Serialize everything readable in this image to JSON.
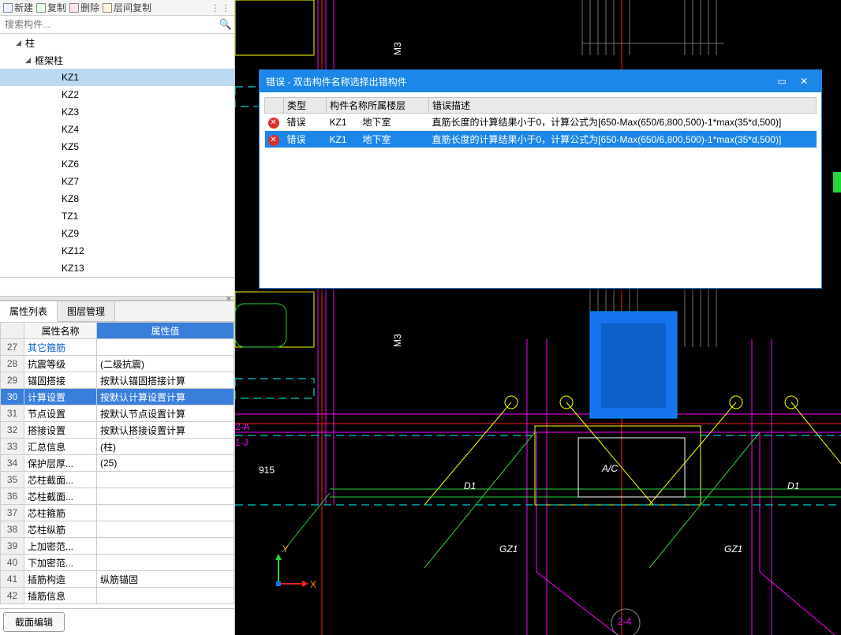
{
  "toolbar": {
    "new": "新建",
    "copy": "复制",
    "delete": "删除",
    "layerCopy": "层间复制"
  },
  "search": {
    "placeholder": "搜索构件..."
  },
  "tree": {
    "root": "柱",
    "group": "框架柱",
    "items": [
      "KZ1",
      "KZ2",
      "KZ3",
      "KZ4",
      "KZ5",
      "KZ6",
      "KZ7",
      "KZ8",
      "TZ1",
      "KZ9",
      "KZ12",
      "KZ13"
    ],
    "selected": "KZ1"
  },
  "tabs": {
    "props": "属性列表",
    "layers": "图层管理"
  },
  "propHeaders": {
    "name": "属性名称",
    "value": "属性值"
  },
  "propRows": [
    {
      "n": "27",
      "name": "其它箍筋",
      "value": "",
      "blue": true
    },
    {
      "n": "28",
      "name": "抗震等级",
      "value": "(二级抗震)"
    },
    {
      "n": "29",
      "name": "锚固搭接",
      "value": "按默认锚固搭接计算"
    },
    {
      "n": "30",
      "name": "计算设置",
      "value": "按默认计算设置计算",
      "sel": true
    },
    {
      "n": "31",
      "name": "节点设置",
      "value": "按默认节点设置计算"
    },
    {
      "n": "32",
      "name": "搭接设置",
      "value": "按默认搭接设置计算"
    },
    {
      "n": "33",
      "name": "汇总信息",
      "value": "(柱)"
    },
    {
      "n": "34",
      "name": "保护层厚...",
      "value": "(25)"
    },
    {
      "n": "35",
      "name": "芯柱截面...",
      "value": ""
    },
    {
      "n": "36",
      "name": "芯柱截面...",
      "value": ""
    },
    {
      "n": "37",
      "name": "芯柱箍筋",
      "value": ""
    },
    {
      "n": "38",
      "name": "芯柱纵筋",
      "value": ""
    },
    {
      "n": "39",
      "name": "上加密范...",
      "value": ""
    },
    {
      "n": "40",
      "name": "下加密范...",
      "value": ""
    },
    {
      "n": "41",
      "name": "插筋构造",
      "value": "纵筋锚固"
    },
    {
      "n": "42",
      "name": "插筋信息",
      "value": ""
    }
  ],
  "bottom": {
    "editSection": "截面编辑"
  },
  "dialog": {
    "title": "错误 - 双击构件名称选择出错构件",
    "cols": {
      "type": "类型",
      "name": "构件名称所属楼层",
      "desc": "错误描述"
    },
    "rows": [
      {
        "type": "错误",
        "comp": "KZ1",
        "floor": "地下室",
        "desc": "直筋长度的计算结果小于0，计算公式为[650-Max(650/6,800,500)-1*max(35*d,500)]",
        "sel": false
      },
      {
        "type": "错误",
        "comp": "KZ1",
        "floor": "地下室",
        "desc": "直筋长度的计算结果小于0，计算公式为[650-Max(650/6,800,500)-1*max(35*d,500)]",
        "sel": true
      }
    ]
  },
  "canvas": {
    "labels": {
      "m3_1": "M3",
      "m3_2": "M3",
      "d1_1": "D1",
      "d1_2": "D1",
      "ac": "A/C",
      "gz1_1": "GZ1",
      "gz1_2": "GZ1",
      "num915": "915",
      "sec2a": "2-A",
      "sec1j": "1-J",
      "sec24": "2-4",
      "axisX": "X",
      "axisY": "Y"
    },
    "colors": {
      "magenta": "#ff00ff",
      "cyan": "#00ffff",
      "yellow": "#ffff00",
      "red": "#ff2020",
      "green": "#29d53f",
      "blue": "#1672ed",
      "white": "#ffffff",
      "grey": "#6f6f6f",
      "orange": "#ff8a00"
    }
  }
}
